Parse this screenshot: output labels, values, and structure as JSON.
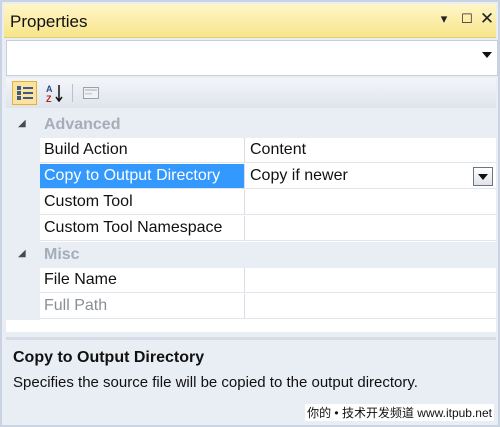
{
  "window": {
    "title": "Properties",
    "pin_glyph": "▾",
    "max_glyph": "☐",
    "close_glyph": "✕"
  },
  "toolbar": {
    "categorized_icon": "categorized-icon",
    "alphabetical_label": "A Z ↓",
    "property_pages_icon": "property-pages-icon"
  },
  "grid": {
    "categories": [
      {
        "label": "Advanced",
        "expanded": true,
        "rows": [
          {
            "name": "Build Action",
            "value": "Content",
            "selected": false
          },
          {
            "name": "Copy to Output Directory",
            "value": "Copy if newer",
            "selected": true
          },
          {
            "name": "Custom Tool",
            "value": "",
            "selected": false
          },
          {
            "name": "Custom Tool Namespace",
            "value": "",
            "selected": false
          }
        ]
      },
      {
        "label": "Misc",
        "expanded": true,
        "rows": [
          {
            "name": "File Name",
            "value": "",
            "selected": false
          },
          {
            "name": "Full Path",
            "value": "",
            "selected": false,
            "readonly": true
          }
        ]
      }
    ]
  },
  "description": {
    "title": "Copy to Output Directory",
    "text": "Specifies the source file will be copied to the output directory."
  },
  "watermark": "你的 • 技术开发频道 www.itpub.net",
  "colors": {
    "selection": "#3399ff",
    "titlebar": "#f7e58a",
    "background": "#e9edf4"
  }
}
